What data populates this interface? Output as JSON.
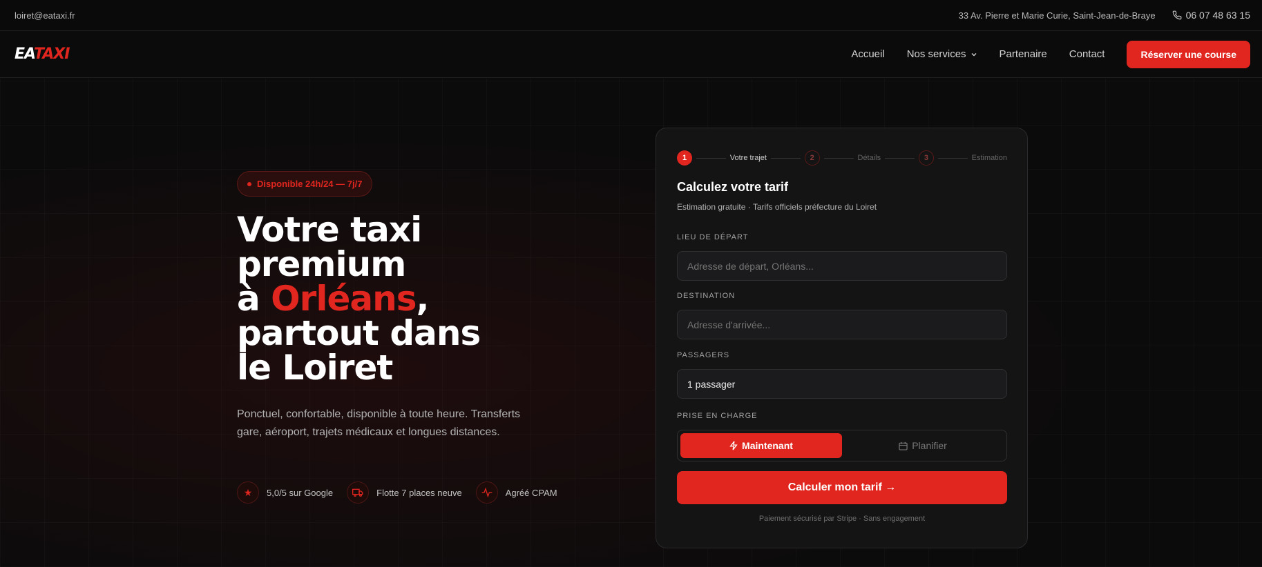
{
  "topbar": {
    "email": "loiret@eataxi.fr",
    "address": "33 Av. Pierre et Marie Curie, Saint-Jean-de-Braye",
    "phone": "06 07 48 63 15"
  },
  "nav": {
    "logo_part1": "EA",
    "logo_part2": "TAXI",
    "links": [
      "Accueil",
      "Nos services",
      "Partenaire",
      "Contact"
    ],
    "cta": "Réserver une course"
  },
  "hero": {
    "badge": "Disponible 24h/24 — 7j/7",
    "headline_line1": "Votre taxi",
    "headline_line2": "premium",
    "headline_line3_pre": "à ",
    "headline_line3_red": "Orléans",
    "headline_line3_post": ",",
    "headline_line4": "partout dans",
    "headline_line5": "le Loiret",
    "subtext": "Ponctuel, confortable, disponible à toute heure. Transferts gare, aéroport, trajets médicaux et longues distances.",
    "features": [
      {
        "icon": "star-icon",
        "label": "5,0/5 sur Google"
      },
      {
        "icon": "truck-icon",
        "label": "Flotte 7 places neuve"
      },
      {
        "icon": "pulse-icon",
        "label": "Agréé CPAM"
      }
    ]
  },
  "form": {
    "steps": [
      {
        "num": "1",
        "label": "Votre trajet"
      },
      {
        "num": "2",
        "label": "Détails"
      },
      {
        "num": "3",
        "label": "Estimation"
      }
    ],
    "title": "Calculez votre tarif",
    "subtitle": "Estimation gratuite · Tarifs officiels préfecture du Loiret",
    "departure_label": "LIEU DE DÉPART",
    "departure_placeholder": "Adresse de départ, Orléans...",
    "destination_label": "DESTINATION",
    "destination_placeholder": "Adresse d'arrivée...",
    "passengers_label": "PASSAGERS",
    "passengers_value": "1 passager",
    "pickup_label": "PRISE EN CHARGE",
    "pickup_now": "Maintenant",
    "pickup_plan": "Planifier",
    "submit": "Calculer mon tarif →",
    "footnote": "Paiement sécurisé par Stripe · Sans engagement"
  },
  "colors": {
    "accent": "#e0261f",
    "background": "#0b0b0c",
    "card": "#141415"
  }
}
